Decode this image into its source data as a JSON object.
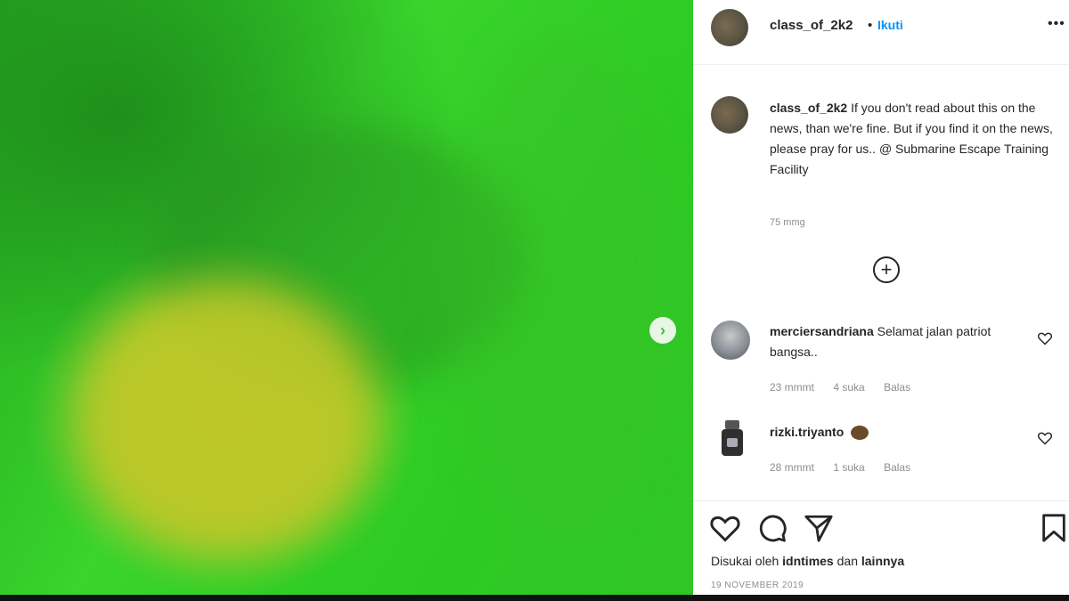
{
  "post": {
    "username": "class_of_2k2",
    "separator": "•",
    "follow_label": "Ikuti",
    "more_label": "•••",
    "caption_username": "class_of_2k2",
    "caption_text": "If you don't read about this on the news, than we're fine. But if you find it on the news, please pray for us.. @ Submarine Escape Training Facility",
    "caption_time": "75 mmg"
  },
  "comments": [
    {
      "username": "merciersandriana",
      "text": "Selamat jalan patriot bangsa..",
      "time": "23 mmmt",
      "likes": "4 suka",
      "reply": "Balas"
    },
    {
      "username": "rizki.triyanto",
      "text": "",
      "time": "28 mmmt",
      "likes": "1 suka",
      "reply": "Balas"
    }
  ],
  "load_more_label": "+",
  "media": {
    "next_label": "›"
  },
  "footer": {
    "liked_prefix": "Disukai oleh",
    "liked_user": "idntimes",
    "liked_mid": "dan",
    "liked_suffix": "lainnya",
    "date": "19 NOVEMBER 2019"
  },
  "icons": {
    "like": "heart-icon",
    "comment": "comment-icon",
    "share": "send-icon",
    "save": "bookmark-icon"
  },
  "colors": {
    "media_green": "#33cc26",
    "link_blue": "#0095f6",
    "text": "#262626",
    "muted": "#8e8e8e"
  }
}
